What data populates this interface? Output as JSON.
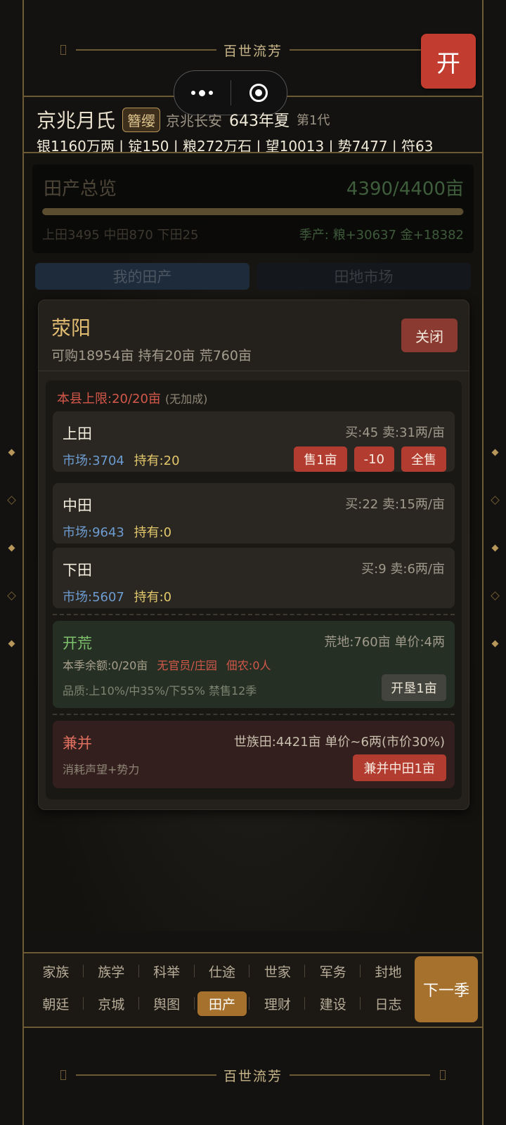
{
  "top_banner": {
    "title": "百世流芳"
  },
  "open_button": {
    "label": "开"
  },
  "header": {
    "clan_name": "京兆月氏",
    "rank_badge": "簪缨",
    "place": "京兆长安",
    "year_season": "643年夏",
    "generation": "第1代",
    "resources": "银1160万两 | 锭150 | 粮272万石 | 望10013 | 势7477 | 符63"
  },
  "overview": {
    "title": "田产总览",
    "count": "4390/4400亩",
    "progress": 0.9977,
    "breakdown": "上田3495 中田870 下田25",
    "season_yield": "季产: 粮+30637 金+18382"
  },
  "tabs": [
    "我的田产",
    "田地市场"
  ],
  "county": {
    "name": "荥阳",
    "summary": "可购18954亩  持有20亩  荒760亩",
    "close_label": "关闭",
    "limit": "本县上限:20/20亩",
    "limit_note": "(无加成)"
  },
  "lands": [
    {
      "name": "上田",
      "price": "买:45 卖:31两/亩",
      "market": "市场:3704",
      "hold": "持有:20",
      "buttons": [
        "售1亩",
        "-10",
        "全售"
      ]
    },
    {
      "name": "中田",
      "price": "买:22 卖:15两/亩",
      "market": "市场:9643",
      "hold": "持有:0"
    },
    {
      "name": "下田",
      "price": "买:9 卖:6两/亩",
      "market": "市场:5607",
      "hold": "持有:0"
    }
  ],
  "reclaim": {
    "title": "开荒",
    "info": "荒地:760亩 单价:4两",
    "quota": "本季余额:0/20亩",
    "warn1": "无官员/庄园",
    "warn2": "佃农:0人",
    "quality": "品质:上10%/中35%/下55% 禁售12季",
    "button": "开垦1亩"
  },
  "annex": {
    "title": "兼并",
    "info": "世族田:4421亩 单价~6两(市价30%)",
    "note": "消耗声望+势力",
    "button": "兼并中田1亩"
  },
  "nav": {
    "items": [
      "家族",
      "族学",
      "科举",
      "仕途",
      "世家",
      "军务",
      "封地",
      "朝廷",
      "京城",
      "舆图",
      "田产",
      "理财",
      "建设",
      "日志"
    ],
    "active": "田产",
    "next_label": "下一季"
  },
  "bottom_banner": {
    "title": "百世流芳"
  },
  "colors": {
    "accent": "#a6712d",
    "danger": "#b23c30",
    "good": "#7dc16c",
    "market": "#6c9cd0"
  }
}
